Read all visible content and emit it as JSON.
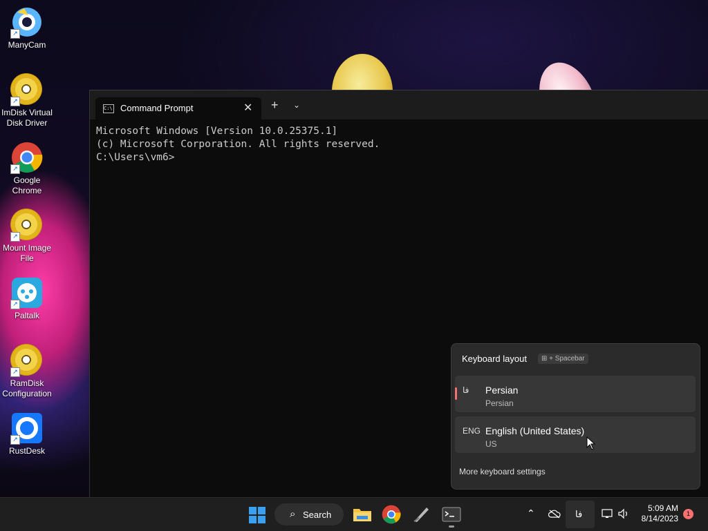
{
  "desktop": {
    "icons": [
      {
        "label": "ManyCam",
        "icon": "manycam-icon"
      },
      {
        "label": "ImDisk Virtual Disk Driver",
        "icon": "disc-icon"
      },
      {
        "label": "Google Chrome",
        "icon": "chrome-icon"
      },
      {
        "label": "Mount Image File",
        "icon": "disc-icon"
      },
      {
        "label": "Paltalk",
        "icon": "paltalk-icon"
      },
      {
        "label": "RamDisk Configuration",
        "icon": "disc-icon"
      },
      {
        "label": "RustDesk",
        "icon": "rustdesk-icon"
      }
    ]
  },
  "terminal": {
    "tab_icon_text": "C:\\",
    "tab_title": "Command Prompt",
    "close_glyph": "✕",
    "new_tab_glyph": "+",
    "dropdown_glyph": "⌄",
    "lines": [
      "Microsoft Windows [Version 10.0.25375.1]",
      "(c) Microsoft Corporation. All rights reserved.",
      "",
      "C:\\Users\\vm6>"
    ]
  },
  "keyboard_flyout": {
    "title": "Keyboard layout",
    "shortcut_hint": "⊞ + Spacebar",
    "layouts": [
      {
        "code": "فا",
        "name": "Persian",
        "sub": "Persian",
        "selected": true
      },
      {
        "code": "ENG",
        "name": "English (United States)",
        "sub": "US",
        "selected": false
      }
    ],
    "more_settings": "More keyboard settings",
    "accent_color": "#f87171"
  },
  "taskbar": {
    "search_label": "Search",
    "ime_indicator": "فا",
    "time": "5:09 AM",
    "date": "8/14/2023",
    "notification_count": "1",
    "start_color": "#3aa0f0"
  }
}
